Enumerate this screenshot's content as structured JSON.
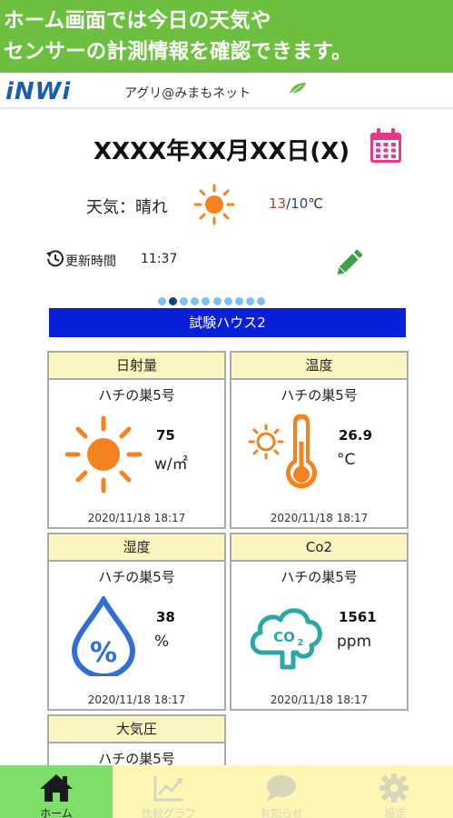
{
  "banner": {
    "line1": "ホーム画面では今日の天気や",
    "line2": "センサーの計測情報を確認できます。"
  },
  "header": {
    "logo": "iNWi",
    "app_name": "アグリ@みまもネット",
    "icons": [
      "leaf-icon"
    ]
  },
  "date": {
    "text": "XXXX年XX月XX日(X)",
    "icon": "calendar-icon",
    "icon_color": "#e8388a"
  },
  "weather": {
    "label": "天気：晴れ",
    "icon": "sun-icon",
    "high": "13",
    "separator": "/",
    "low": "10",
    "unit": "℃"
  },
  "update": {
    "label": "更新時間",
    "time": "11:37",
    "icons": [
      "history-icon",
      "pencil-icon"
    ]
  },
  "pager": {
    "count": 10,
    "active_index": 1
  },
  "house": {
    "name": "試験ハウス2"
  },
  "cards": [
    {
      "title": "日射量",
      "device": "ハチの巣5号",
      "value": "75",
      "unit": "w/㎡",
      "date": "2020/11/18 18:17",
      "icon": "sun-icon"
    },
    {
      "title": "温度",
      "device": "ハチの巣5号",
      "value": "26.9",
      "unit": "°C",
      "date": "2020/11/18 18:17",
      "icon": "thermometer-icon"
    },
    {
      "title": "湿度",
      "device": "ハチの巣5号",
      "value": "38",
      "unit": "%",
      "date": "2020/11/18 18:17",
      "icon": "humidity-drop-icon"
    },
    {
      "title": "Co2",
      "device": "ハチの巣5号",
      "value": "1561",
      "unit": "ppm",
      "date": "2020/11/18 18:17",
      "icon": "co2-cloud-icon"
    },
    {
      "title": "大気圧",
      "device": "ハチの巣5号"
    }
  ],
  "tabs": [
    {
      "label": "ホーム",
      "icon": "home-icon",
      "active": true
    },
    {
      "label": "比較グラフ",
      "icon": "chart-icon",
      "active": false
    },
    {
      "label": "お知らせ",
      "icon": "chat-bubble-icon",
      "active": false
    },
    {
      "label": "設定",
      "icon": "gear-icon",
      "active": false
    }
  ],
  "colors": {
    "banner": "#6cbf3f",
    "house_bar": "#0a20d8",
    "card_title_bg": "#fbf5c0",
    "accent_orange": "#f58220",
    "tab_active": "#7ee06a",
    "tabbar_bg": "#fdf6b5"
  }
}
